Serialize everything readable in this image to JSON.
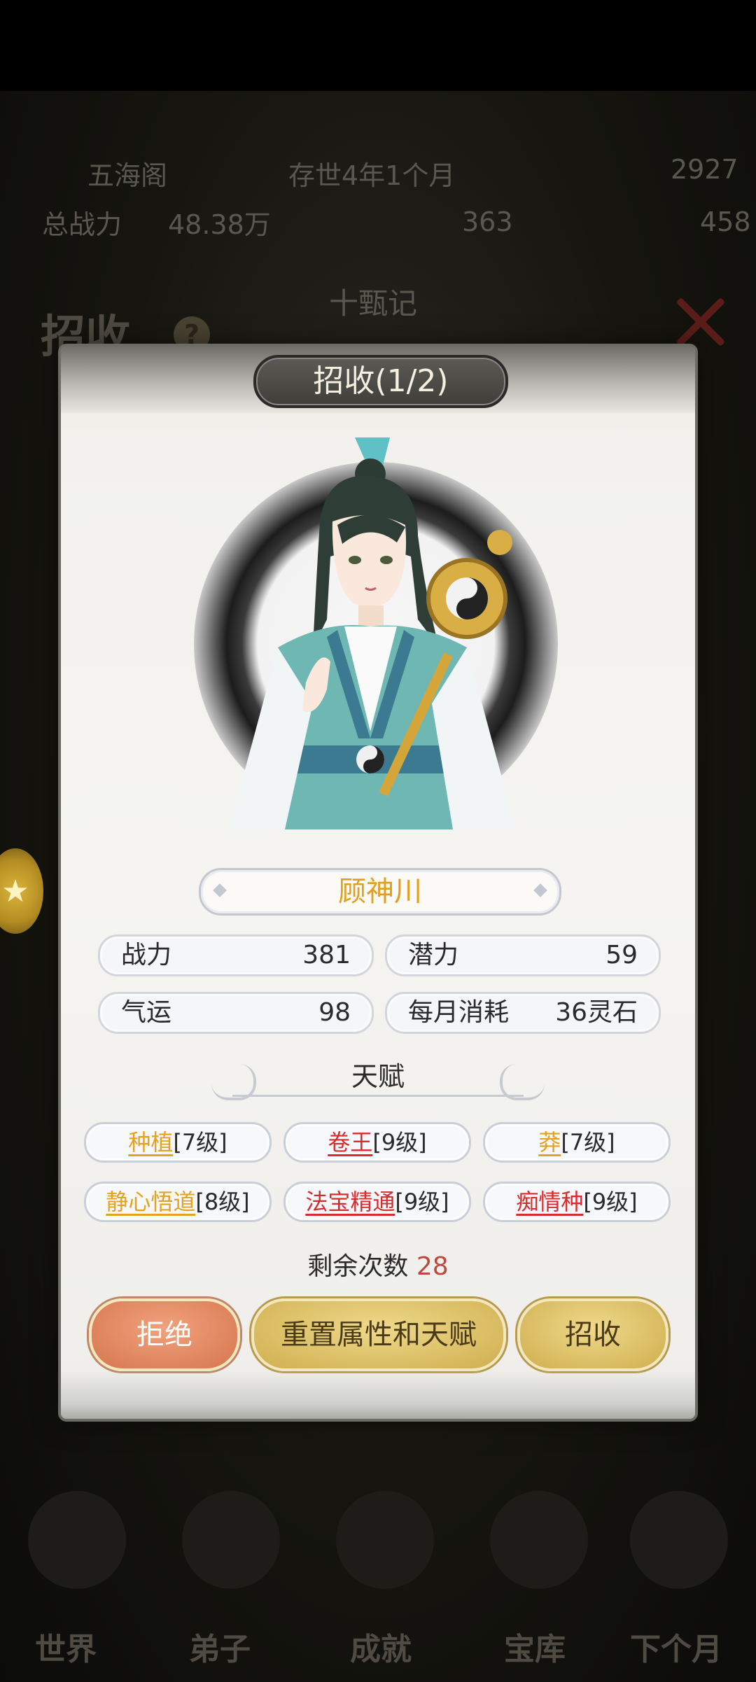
{
  "background": {
    "sect_name": "五海阁",
    "time": "存世4年1个月",
    "power_label": "总战力",
    "power_value": "48.38万",
    "panel_title": "招收",
    "help": "?",
    "res1_value": "363",
    "res2_value": "458",
    "res3_value": "2927",
    "tab_label": "十甄记",
    "nav": [
      "世界",
      "弟子",
      "成就",
      "宝库",
      "下个月"
    ]
  },
  "modal": {
    "title": "招收(1/2)",
    "name": "顾神川",
    "stats": [
      {
        "label": "战力",
        "value": "381"
      },
      {
        "label": "潜力",
        "value": "59"
      },
      {
        "label": "气运",
        "value": "98"
      },
      {
        "label": "每月消耗",
        "value": "36灵石"
      }
    ],
    "talent_header": "天赋",
    "talents": [
      {
        "name": "种植",
        "level": "[7级]",
        "color": "#e3a21f"
      },
      {
        "name": "卷王",
        "level": "[9级]",
        "color": "#d62c2c"
      },
      {
        "name": "莽",
        "level": "[7级]",
        "color": "#e3a21f"
      },
      {
        "name": "静心悟道",
        "level": "[8级]",
        "color": "#e3a21f"
      },
      {
        "name": "法宝精通",
        "level": "[9级]",
        "color": "#d62c2c"
      },
      {
        "name": "痴情种",
        "level": "[9级]",
        "color": "#d62c2c"
      }
    ],
    "remaining_label": "剩余次数",
    "remaining_value": "28",
    "buttons": {
      "reject": "拒绝",
      "reset": "重置属性和天赋",
      "accept": "招收"
    }
  }
}
